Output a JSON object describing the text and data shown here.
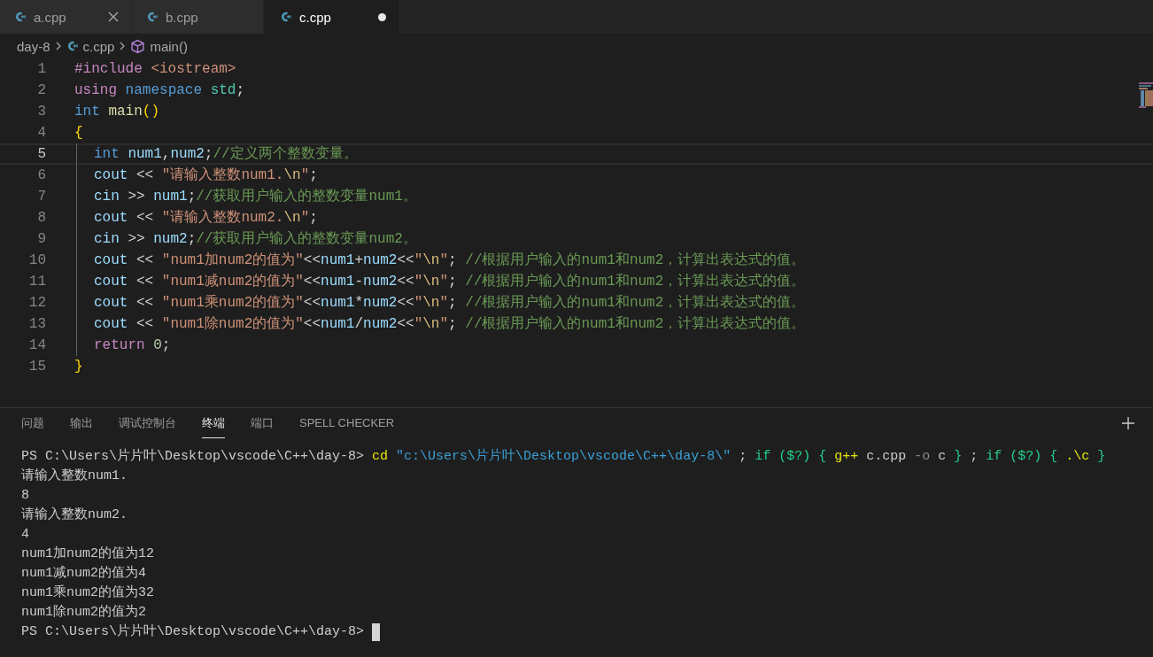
{
  "tabs": [
    {
      "label": "a.cpp",
      "selected": false,
      "hovered": true,
      "modified": false
    },
    {
      "label": "b.cpp",
      "selected": false,
      "hovered": false,
      "modified": false
    },
    {
      "label": "c.cpp",
      "selected": true,
      "hovered": false,
      "modified": true
    }
  ],
  "breadcrumb": [
    {
      "kind": "folder",
      "label": "day-8"
    },
    {
      "kind": "file",
      "label": "c.cpp"
    },
    {
      "kind": "symbol",
      "label": "main()"
    }
  ],
  "code_lines": [
    {
      "number": "1",
      "current": false,
      "indented": false,
      "tokens": [
        {
          "kind": "preproc",
          "text": "#include"
        },
        {
          "kind": "string",
          "text": " <iostream>"
        }
      ]
    },
    {
      "number": "2",
      "current": false,
      "indented": false,
      "tokens": [
        {
          "kind": "control",
          "text": "using"
        },
        {
          "kind": "keyword",
          "text": " namespace"
        },
        {
          "kind": "type",
          "text": " std"
        },
        {
          "kind": "plain",
          "text": ";"
        }
      ]
    },
    {
      "number": "3",
      "current": false,
      "indented": false,
      "tokens": [
        {
          "kind": "keyword",
          "text": "int"
        },
        {
          "kind": "func",
          "text": " main"
        },
        {
          "kind": "bracket",
          "text": "()"
        }
      ]
    },
    {
      "number": "4",
      "current": false,
      "indented": false,
      "tokens": [
        {
          "kind": "bracket",
          "text": "{"
        }
      ]
    },
    {
      "number": "5",
      "current": true,
      "indented": true,
      "tokens": [
        {
          "kind": "keyword",
          "text": "int"
        },
        {
          "kind": "var",
          "text": " num1"
        },
        {
          "kind": "plain",
          "text": ","
        },
        {
          "kind": "var",
          "text": "num2"
        },
        {
          "kind": "plain",
          "text": ";"
        },
        {
          "kind": "comment",
          "text": "//定义两个整数变量。"
        }
      ]
    },
    {
      "number": "6",
      "current": false,
      "indented": true,
      "tokens": [
        {
          "kind": "var",
          "text": "cout"
        },
        {
          "kind": "plain",
          "text": " << "
        },
        {
          "kind": "string",
          "text": "\"请输入整数num1."
        },
        {
          "kind": "escape",
          "text": "\\n"
        },
        {
          "kind": "string",
          "text": "\""
        },
        {
          "kind": "plain",
          "text": ";"
        }
      ]
    },
    {
      "number": "7",
      "current": false,
      "indented": true,
      "tokens": [
        {
          "kind": "var",
          "text": "cin"
        },
        {
          "kind": "plain",
          "text": " >> "
        },
        {
          "kind": "var",
          "text": "num1"
        },
        {
          "kind": "plain",
          "text": ";"
        },
        {
          "kind": "comment",
          "text": "//获取用户输入的整数变量num1。"
        }
      ]
    },
    {
      "number": "8",
      "current": false,
      "indented": true,
      "tokens": [
        {
          "kind": "var",
          "text": "cout"
        },
        {
          "kind": "plain",
          "text": " << "
        },
        {
          "kind": "string",
          "text": "\"请输入整数num2."
        },
        {
          "kind": "escape",
          "text": "\\n"
        },
        {
          "kind": "string",
          "text": "\""
        },
        {
          "kind": "plain",
          "text": ";"
        }
      ]
    },
    {
      "number": "9",
      "current": false,
      "indented": true,
      "tokens": [
        {
          "kind": "var",
          "text": "cin"
        },
        {
          "kind": "plain",
          "text": " >> "
        },
        {
          "kind": "var",
          "text": "num2"
        },
        {
          "kind": "plain",
          "text": ";"
        },
        {
          "kind": "comment",
          "text": "//获取用户输入的整数变量num2。"
        }
      ]
    },
    {
      "number": "10",
      "current": false,
      "indented": true,
      "tokens": [
        {
          "kind": "var",
          "text": "cout"
        },
        {
          "kind": "plain",
          "text": " << "
        },
        {
          "kind": "string",
          "text": "\"num1加num2的值为\""
        },
        {
          "kind": "plain",
          "text": "<<"
        },
        {
          "kind": "var",
          "text": "num1"
        },
        {
          "kind": "plain",
          "text": "+"
        },
        {
          "kind": "var",
          "text": "num2"
        },
        {
          "kind": "plain",
          "text": "<<"
        },
        {
          "kind": "string",
          "text": "\""
        },
        {
          "kind": "escape",
          "text": "\\n"
        },
        {
          "kind": "string",
          "text": "\""
        },
        {
          "kind": "plain",
          "text": ";"
        },
        {
          "kind": "comment",
          "text": " //根据用户输入的num1和num2，计算出表达式的值。"
        }
      ]
    },
    {
      "number": "11",
      "current": false,
      "indented": true,
      "tokens": [
        {
          "kind": "var",
          "text": "cout"
        },
        {
          "kind": "plain",
          "text": " << "
        },
        {
          "kind": "string",
          "text": "\"num1减num2的值为\""
        },
        {
          "kind": "plain",
          "text": "<<"
        },
        {
          "kind": "var",
          "text": "num1"
        },
        {
          "kind": "plain",
          "text": "-"
        },
        {
          "kind": "var",
          "text": "num2"
        },
        {
          "kind": "plain",
          "text": "<<"
        },
        {
          "kind": "string",
          "text": "\""
        },
        {
          "kind": "escape",
          "text": "\\n"
        },
        {
          "kind": "string",
          "text": "\""
        },
        {
          "kind": "plain",
          "text": ";"
        },
        {
          "kind": "comment",
          "text": " //根据用户输入的num1和num2，计算出表达式的值。"
        }
      ]
    },
    {
      "number": "12",
      "current": false,
      "indented": true,
      "tokens": [
        {
          "kind": "var",
          "text": "cout"
        },
        {
          "kind": "plain",
          "text": " << "
        },
        {
          "kind": "string",
          "text": "\"num1乘num2的值为\""
        },
        {
          "kind": "plain",
          "text": "<<"
        },
        {
          "kind": "var",
          "text": "num1"
        },
        {
          "kind": "plain",
          "text": "*"
        },
        {
          "kind": "var",
          "text": "num2"
        },
        {
          "kind": "plain",
          "text": "<<"
        },
        {
          "kind": "string",
          "text": "\""
        },
        {
          "kind": "escape",
          "text": "\\n"
        },
        {
          "kind": "string",
          "text": "\""
        },
        {
          "kind": "plain",
          "text": ";"
        },
        {
          "kind": "comment",
          "text": " //根据用户输入的num1和num2，计算出表达式的值。"
        }
      ]
    },
    {
      "number": "13",
      "current": false,
      "indented": true,
      "tokens": [
        {
          "kind": "var",
          "text": "cout"
        },
        {
          "kind": "plain",
          "text": " << "
        },
        {
          "kind": "string",
          "text": "\"num1除num2的值为\""
        },
        {
          "kind": "plain",
          "text": "<<"
        },
        {
          "kind": "var",
          "text": "num1"
        },
        {
          "kind": "plain",
          "text": "/"
        },
        {
          "kind": "var",
          "text": "num2"
        },
        {
          "kind": "plain",
          "text": "<<"
        },
        {
          "kind": "string",
          "text": "\""
        },
        {
          "kind": "escape",
          "text": "\\n"
        },
        {
          "kind": "string",
          "text": "\""
        },
        {
          "kind": "plain",
          "text": ";"
        },
        {
          "kind": "comment",
          "text": " //根据用户输入的num1和num2，计算出表达式的值。"
        }
      ]
    },
    {
      "number": "14",
      "current": false,
      "indented": true,
      "tokens": [
        {
          "kind": "control",
          "text": "return"
        },
        {
          "kind": "number",
          "text": " 0"
        },
        {
          "kind": "plain",
          "text": ";"
        }
      ]
    },
    {
      "number": "15",
      "current": false,
      "indented": false,
      "tokens": [
        {
          "kind": "bracket",
          "text": "}"
        }
      ]
    }
  ],
  "panel_tabs": [
    {
      "label": "问题",
      "selected": false
    },
    {
      "label": "输出",
      "selected": false
    },
    {
      "label": "调试控制台",
      "selected": false
    },
    {
      "label": "终端",
      "selected": true
    },
    {
      "label": "端口",
      "selected": false
    },
    {
      "label": "SPELL CHECKER",
      "selected": false
    }
  ],
  "terminal_lines": [
    {
      "kind": "command",
      "prompt": "PS C:\\Users\\片片叶\\Desktop\\vscode\\C++\\day-8>",
      "tokens": [
        {
          "kind": "cmd",
          "text": "cd"
        },
        {
          "kind": "str",
          "text": " \"c:\\Users\\片片叶\\Desktop\\vscode\\C++\\day-8\\\""
        },
        {
          "kind": "plain",
          "text": " ; "
        },
        {
          "kind": "kw",
          "text": "if ($?) {"
        },
        {
          "kind": "cmd",
          "text": " g++"
        },
        {
          "kind": "plain",
          "text": " c.cpp "
        },
        {
          "kind": "param",
          "text": "-o"
        },
        {
          "kind": "plain",
          "text": " c "
        },
        {
          "kind": "kw",
          "text": "}"
        },
        {
          "kind": "plain",
          "text": " ; "
        },
        {
          "kind": "kw",
          "text": "if ($?) {"
        },
        {
          "kind": "cmd",
          "text": " .\\c"
        },
        {
          "kind": "kw",
          "text": " }"
        }
      ]
    },
    {
      "kind": "output",
      "text": "请输入整数num1."
    },
    {
      "kind": "output",
      "text": "8"
    },
    {
      "kind": "output",
      "text": "请输入整数num2."
    },
    {
      "kind": "output",
      "text": "4"
    },
    {
      "kind": "output",
      "text": "num1加num2的值为12"
    },
    {
      "kind": "output",
      "text": "num1减num2的值为4"
    },
    {
      "kind": "output",
      "text": "num1乘num2的值为32"
    },
    {
      "kind": "output",
      "text": "num1除num2的值为2"
    },
    {
      "kind": "prompt",
      "prompt": "PS C:\\Users\\片片叶\\Desktop\\vscode\\C++\\day-8>",
      "cursor": true
    }
  ]
}
